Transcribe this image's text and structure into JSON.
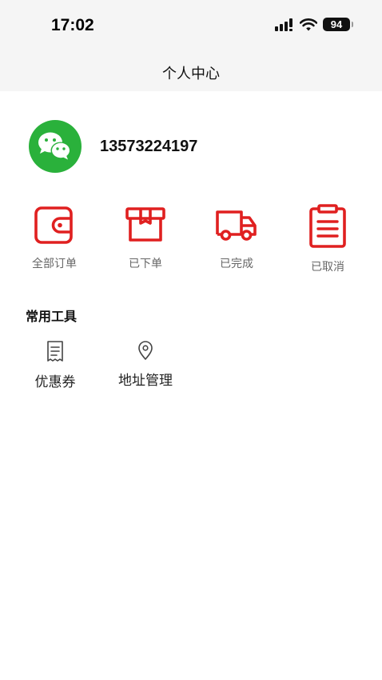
{
  "status_bar": {
    "time": "17:02",
    "battery": "94",
    "icons": [
      "signal-icon",
      "wifi-icon",
      "battery-icon"
    ]
  },
  "header": {
    "title": "个人中心"
  },
  "profile": {
    "avatar_icon": "wechat-icon",
    "avatar_color": "#2ab13b",
    "phone": "13573224197"
  },
  "orders": [
    {
      "label": "全部订单",
      "icon": "wallet-icon"
    },
    {
      "label": "已下单",
      "icon": "package-icon"
    },
    {
      "label": "已完成",
      "icon": "truck-icon"
    },
    {
      "label": "已取消",
      "icon": "clipboard-icon"
    }
  ],
  "accent_color": "#e02020",
  "tools_section": {
    "title": "常用工具",
    "items": [
      {
        "label": "优惠券",
        "icon": "receipt-icon"
      },
      {
        "label": "地址管理",
        "icon": "location-pin-icon"
      }
    ]
  }
}
